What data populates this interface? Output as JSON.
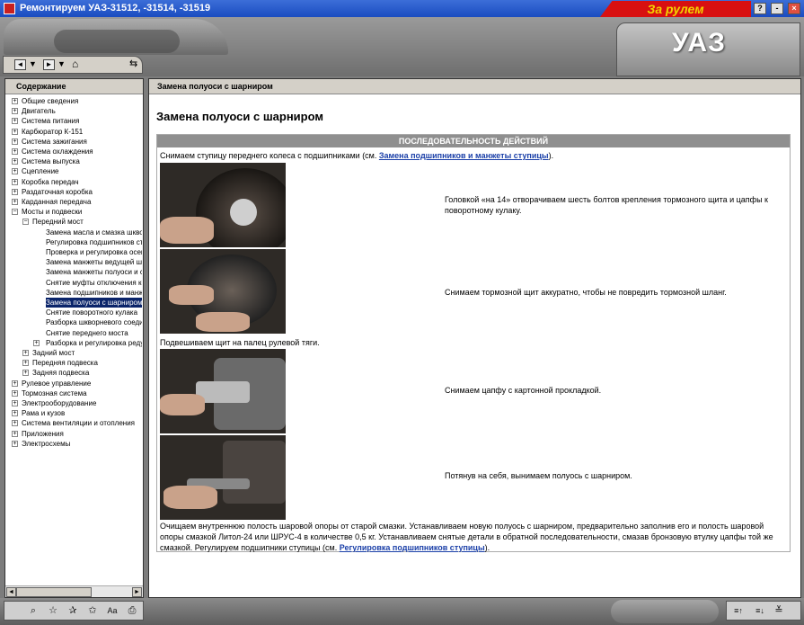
{
  "window": {
    "title": "Ремонтируем УАЗ-31512, -31514, -31519",
    "brand_badge": "За рулем",
    "help_btn": "?",
    "min_btn": "-",
    "close_btn": "×"
  },
  "header": {
    "logo": "УАЗ"
  },
  "toolbar": {
    "back": "◄",
    "back_menu": "▼",
    "forward": "►",
    "forward_menu": "▼",
    "home": "⌂",
    "sync": "⇆"
  },
  "sidebar": {
    "title": "Содержание",
    "items": [
      {
        "label": "Общие сведения",
        "level": 0,
        "exp": "+"
      },
      {
        "label": "Двигатель",
        "level": 0,
        "exp": "+"
      },
      {
        "label": "Система питания",
        "level": 0,
        "exp": "+"
      },
      {
        "label": "Карбюратор К-151",
        "level": 0,
        "exp": "+"
      },
      {
        "label": "Система зажигания",
        "level": 0,
        "exp": "+"
      },
      {
        "label": "Система охлаждения",
        "level": 0,
        "exp": "+"
      },
      {
        "label": "Система выпуска",
        "level": 0,
        "exp": "+"
      },
      {
        "label": "Сцепление",
        "level": 0,
        "exp": "+"
      },
      {
        "label": "Коробка передач",
        "level": 0,
        "exp": "+"
      },
      {
        "label": "Раздаточная коробка",
        "level": 0,
        "exp": "+"
      },
      {
        "label": "Карданная передача",
        "level": 0,
        "exp": "+"
      },
      {
        "label": "Мосты и подвески",
        "level": 0,
        "exp": "−"
      },
      {
        "label": "Передний мост",
        "level": 1,
        "exp": "−"
      },
      {
        "label": "Замена масла и смазка шкво",
        "level": 2,
        "exp": ""
      },
      {
        "label": "Регулировка подшипников сту",
        "level": 2,
        "exp": ""
      },
      {
        "label": "Проверка и регулировка осев",
        "level": 2,
        "exp": ""
      },
      {
        "label": "Замена манжеты ведущей ше",
        "level": 2,
        "exp": ""
      },
      {
        "label": "Замена манжеты полуоси и с",
        "level": 2,
        "exp": ""
      },
      {
        "label": "Снятие муфты отключения ко",
        "level": 2,
        "exp": ""
      },
      {
        "label": "Замена подшипников и манже",
        "level": 2,
        "exp": ""
      },
      {
        "label": "Замена полуоси с шарниром",
        "level": 2,
        "exp": "",
        "selected": true
      },
      {
        "label": "Снятие поворотного кулака",
        "level": 2,
        "exp": ""
      },
      {
        "label": "Разборка шкворневого соеди",
        "level": 2,
        "exp": ""
      },
      {
        "label": "Снятие переднего моста",
        "level": 2,
        "exp": ""
      },
      {
        "label": "Разборка и регулировка реду",
        "level": 2,
        "exp": "+"
      },
      {
        "label": "Задний мост",
        "level": 1,
        "exp": "+"
      },
      {
        "label": "Передняя подвеска",
        "level": 1,
        "exp": "+"
      },
      {
        "label": "Задняя подвеска",
        "level": 1,
        "exp": "+"
      },
      {
        "label": "Рулевое управление",
        "level": 0,
        "exp": "+"
      },
      {
        "label": "Тормозная система",
        "level": 0,
        "exp": "+"
      },
      {
        "label": "Электрооборудование",
        "level": 0,
        "exp": "+"
      },
      {
        "label": "Рама и кузов",
        "level": 0,
        "exp": "+"
      },
      {
        "label": "Система вентиляции и отопления",
        "level": 0,
        "exp": "+"
      },
      {
        "label": "Приложения",
        "level": 0,
        "exp": "+"
      },
      {
        "label": "Электросхемы",
        "level": 0,
        "exp": "+"
      }
    ],
    "scroll_left": "◄",
    "scroll_right": "►"
  },
  "main": {
    "breadcrumb": "Замена полуоси с шарниром",
    "title": "Замена полуоси с шарниром",
    "section_header": "ПОСЛЕДОВАТЕЛЬНОСТЬ ДЕЙСТВИЙ",
    "intro_text": "Снимаем ступицу переднего колеса с подшипниками (см. ",
    "intro_link": "Замена подшипников и манжеты ступицы",
    "intro_end": ").",
    "step1": "Головкой «на 14» отворачиваем шесть болтов крепления тормозного щита и цапфы к поворотному кулаку.",
    "step2": "Снимаем тормозной щит аккуратно, чтобы не повредить тормозной шланг.",
    "mid_text": "Подвешиваем щит на палец рулевой тяги.",
    "step3": "Снимаем цапфу с картонной прокладкой.",
    "step4": "Потянув на себя, вынимаем полуось с шарниром.",
    "final_text": "Очищаем внутреннюю полость шаровой опоры от старой смазки. Устанавливаем новую полуось с шарниром, предварительно заполнив его и полость шаровой опоры смазкой Литол-24 или ШРУС-4 в количестве 0,5 кг. Устанавливаем снятые детали в обратной последовательности, смазав бронзовую втулку цапфы той же смазкой. Регулируем подшипники ступицы (см. ",
    "final_link": "Регулировка подшипников ступицы",
    "final_end": ")."
  },
  "bottom": {
    "search": "⌕",
    "favorites": "☆",
    "add_favorite": "✰",
    "remove_favorite": "✩",
    "font": "Aa",
    "print": "⎙",
    "sort_up": "≡↑",
    "sort_down": "≡↓",
    "collapse": "≚"
  }
}
